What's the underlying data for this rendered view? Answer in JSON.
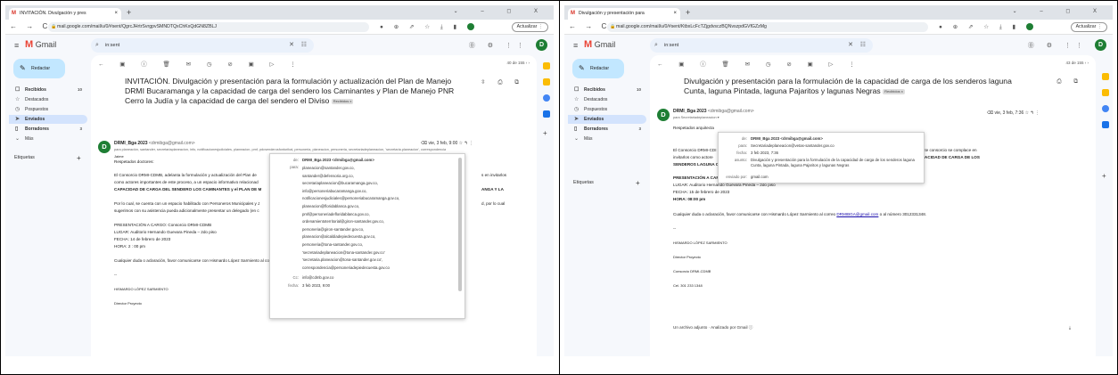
{
  "brand": {
    "gmail_red": "#ea4335",
    "avatar_green": "#1e7e34",
    "compose_blue": "#c2e7ff",
    "active_nav": "#d3e3fd"
  },
  "browser": {
    "new_tab": "+",
    "window_controls": "⌄ – ◻ X",
    "nav_buttons": "← → C",
    "update_button": "Actualizar ⋮"
  },
  "gmail": {
    "menu_icon": "≡",
    "logo_mark": "M",
    "logo_text": "Gmail",
    "search_value": "in:sent",
    "compose": "Redactar",
    "labels_heading": "Etiquetas",
    "header_icons": "⓪ ⚙ ⋮⋮",
    "avatar": "D"
  },
  "left": {
    "tab_title": "INVITACIÓN. Divulgación y pres",
    "url": "mail.google.com/mail/u/0/#sent/QgrcJHrtrSvrgpvSMNDTQxChKxQdGN8ZBLJ",
    "nav": [
      {
        "icon": "☐",
        "label": "Recibidos",
        "count": "10",
        "active": false,
        "bold": true
      },
      {
        "icon": "☆",
        "label": "Destacados",
        "count": "",
        "active": false,
        "bold": false
      },
      {
        "icon": "◷",
        "label": "Pospuestos",
        "count": "",
        "active": false,
        "bold": false
      },
      {
        "icon": "➤",
        "label": "Enviados",
        "count": "",
        "active": true,
        "bold": true
      },
      {
        "icon": "▯",
        "label": "Borradores",
        "count": "3",
        "active": false,
        "bold": true
      },
      {
        "icon": "⌄",
        "label": "Más",
        "count": "",
        "active": false,
        "bold": false
      }
    ],
    "toolbar": "← ▣ ⓘ 🗑 ✉ ◷ ⊘ ▣ ▷ ⋮",
    "pager": "40 de 155  ‹  ›",
    "subject": "INVITACIÓN. Divulgación y presentación para la formulación y actualización del Plan de Manejo DRMI Bucaramanga y la capacidad de carga del sendero los Caminantes y Plan de Manejo PNR Cerro la Judía y la capacidad de carga del sendero el Diviso",
    "badge": "Recibidos x",
    "subject_icons": "⇳ ⎙ ⧉",
    "sender_name": "DRMI_Bga 2023",
    "sender_email": "<drmibga@gmail.com>",
    "sender_time": "⌫ vie, 3 feb, 9:00   ☆  ↰  ⋮",
    "recipients_line": "para planeación, santander, secretariaplaneacion, info, notificacionesjudiciales, planeacion, pmf, pdcsenderosfontoribal, personeria, planeacion, personeria, secretariadeplaneacion, 'secretaria.planeacion', correspondencia",
    "greeting": "Jaime",
    "body": [
      {
        "text": "Respetados doctores:",
        "bold": false
      },
      {
        "text": "El Consorcio DRMI-CDMB, adelanta la formulación y actualización del Plan de",
        "bold": false
      },
      {
        "text": "como actores importantes de este proceso, a un espacio informativo relacionad",
        "bold": false
      },
      {
        "text": "CAPACIDAD DE CARGA DEL SENDERO LOS CAMINANTES y el PLAN DE M",
        "bold": true
      },
      {
        "text": "Por lo cual, se cuenta con un espacio habilitado con Personeros Municipales y J",
        "bold": false
      },
      {
        "text": "sugerimos con su asistencia pueda adicionalmente presentar un delegado (en c",
        "bold": false
      },
      {
        "text": "PRESENTACIÓN A CARGO: Consorcio DRMI-CDMB",
        "bold": true
      },
      {
        "text": "LUGAR: Auditorio Hernando Guevara Pineda – 2do piso",
        "bold": true
      },
      {
        "text": "FECHA: 14 de febrero de 2023",
        "bold": true
      },
      {
        "text": "HORA: 2 : 00 pm",
        "bold": true
      }
    ],
    "right_fragments": [
      "s en invitarlos",
      "ANGA Y LA",
      "d, por lo cual"
    ],
    "contact_line_prefix": "Cualquier duda o aclaración, favor comunicarse con Hismardo López Sarmiento al correo ",
    "contact_email": "DRMIBGA@gmail.com",
    "contact_line_suffix": " o al número 3012331348.",
    "dash": "--",
    "signature_name": "HISMARDO LÓPEZ SARMIENTO",
    "signature_role": "Director Proyecto",
    "popup": {
      "de_label": "de:",
      "de_value": "DRMI_Bga 2023 <drmibga@gmail.com>",
      "para_label": "para:",
      "para_list": [
        "planeacion@santander.gov.co,",
        "santander@defensoria.org.co,",
        "secretariaplaneacion@bucaramanga.gov.co,",
        "info@personeriabucaramanga.gov.co,",
        "notificacionesjudiciales@personeriabucaramanga.gov.co,",
        "planeacion@floridablanca.gov.co,",
        "pmf@personeriadefloridablanca.gov.co,",
        "ordenamientoterritorial@giron-santander.gov.co,",
        "personeria@giron-santander.gov.co,",
        "planeacion@alcaldiadepiedecuesta.gov.co,",
        "personeria@tona-santander.gov.co,",
        "'secretariadeplaneacion@tona-santander.gov.co'",
        "'secretaria.planeacion@tona-santander.gov.co',",
        "correspondencia@personeriadepiedecuesta.gov.co"
      ],
      "cc_label": "Cc:",
      "cc_value": "info@cdmb.gov.co",
      "fecha_label": "fecha:",
      "fecha_value": "3 feb 2023, 9:00"
    }
  },
  "right": {
    "tab_title": "Divulgación y presentación para",
    "url": "mail.google.com/mail/u/0/#sent/KtbxLcFcTZjgdvsczBQNvszpdGVfGZzMg",
    "nav": [
      {
        "icon": "☐",
        "label": "Recibidos",
        "count": "10",
        "active": false,
        "bold": true
      },
      {
        "icon": "☆",
        "label": "Destacados",
        "count": "",
        "active": false,
        "bold": false
      },
      {
        "icon": "◷",
        "label": "Pospuestos",
        "count": "",
        "active": false,
        "bold": false
      },
      {
        "icon": "➤",
        "label": "Enviados",
        "count": "",
        "active": true,
        "bold": true
      },
      {
        "icon": "▯",
        "label": "Borradores",
        "count": "3",
        "active": false,
        "bold": true
      },
      {
        "icon": "⌄",
        "label": "Más",
        "count": "",
        "active": false,
        "bold": false
      }
    ],
    "toolbar": "← ▣ ⓘ 🗑 ✉ ◷ ⊘ ▣ ▷ ⋮",
    "pager": "43 de 155  ‹  ›",
    "subject": "Divulgación y presentación para la formulación de la capacidad de carga de los senderos laguna Cunta, laguna Pintada, laguna Pajaritos y lagunas Negras",
    "badge": "Recibidos x",
    "subject_icons": "⎙ ⧉",
    "sender_name": "DRMI_Bga 2023",
    "sender_email": "<drmibga@gmail.com>",
    "sender_time": "⌫ vie, 3 feb, 7:36   ☆  ↰  ⋮",
    "recipients_line": "para Secretariadeplaneacion ▾",
    "greeting": "Respetados arquitecta",
    "body": [
      {
        "text": "El Consorcio DRMI-CDI",
        "bold": false
      },
      {
        "text": "invitarlos como actore",
        "bold": false
      },
      {
        "text": "SENDEROS LAGUNA C",
        "bold": true
      },
      {
        "text": "PRESENTACIÓN A CAR",
        "bold": true
      },
      {
        "text": "LUGAR: Auditorio Hernando Guevara Pineda – 2do piso",
        "bold": true
      },
      {
        "text": "FECHA: 15 de febrero de 2023",
        "bold": true
      },
      {
        "text": "HORA: 08:00 pm",
        "bold": true
      }
    ],
    "right_fragments": [
      "urbán (PNR Santurbán); por tanto, este consorcio se complace en",
      "para la FORMULACIÓN DE LA CAPACIDAD DE CARGA DE LOS"
    ],
    "contact_line_prefix": "Cualquier duda o aclaración, favor comunicarse con Hismardo López Sarmiento al correo ",
    "contact_email": "DRMIBGA@gmail.com",
    "contact_line_suffix": " o al número 3012331348.",
    "dash": "--",
    "signature_name": "HISMARDO LÓPEZ SARMIENTO",
    "signature_role": "Director Proyecto",
    "signature_org": "Consorcio DRMI-CDMB",
    "signature_phone": "Cel. 301 233 1348",
    "attachment": "Un archivo adjunto · Analizado por Gmail ⓘ",
    "popup": {
      "de_label": "de:",
      "de_value": "DRMI_Bga 2023 <drmibga@gmail.com>",
      "para_label": "para:",
      "para_value": "Secretariadeplaneacion@vetas-santander.gov.co",
      "fecha_label": "fecha:",
      "fecha_value": "3 feb 2023, 7:36",
      "asunto_label": "asunto:",
      "asunto_value": "Divulgación y presentación para la formulación de la capacidad de carga de los senderos laguna Cunta, laguna Pintada, laguna Pajaritos y lagunas Negras",
      "enviado_label": "enviado por:",
      "enviado_value": "gmail.com"
    }
  }
}
